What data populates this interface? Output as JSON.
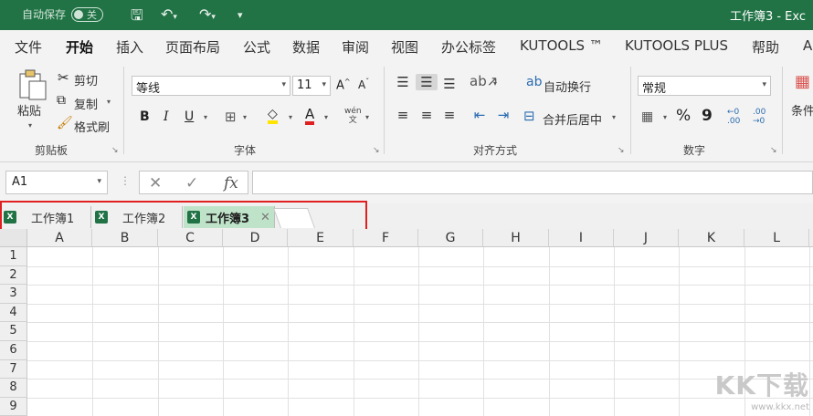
{
  "titlebar": {
    "autosave_label": "自动保存",
    "autosave_state": "关",
    "title": "工作簿3  -  Exc"
  },
  "menu": [
    "文件",
    "开始",
    "插入",
    "页面布局",
    "公式",
    "数据",
    "审阅",
    "视图",
    "办公标签",
    "KUTOOLS ™",
    "KUTOOLS PLUS",
    "帮助",
    "A"
  ],
  "menu_active": "开始",
  "ribbon": {
    "clipboard": {
      "paste": "粘贴",
      "cut": "剪切",
      "copy": "复制",
      "format_painter": "格式刷",
      "label": "剪贴板"
    },
    "font": {
      "font_name": "等线",
      "font_size": "11",
      "bold": "B",
      "italic": "I",
      "underline": "U",
      "grow": "A˄",
      "shrink": "A˅",
      "wen": "wén\n文",
      "label": "字体"
    },
    "align": {
      "wrap": "自动换行",
      "merge": "合并后居中",
      "label": "对齐方式"
    },
    "number": {
      "format": "常规",
      "percent": "%",
      "comma": "9",
      "inc": "←0\n.00",
      "dec": ".00\n→0",
      "label": "数字"
    },
    "styles": {
      "cond": "条件"
    }
  },
  "formula": {
    "namebox": "A1",
    "cancel": "✕",
    "enter": "✓",
    "fx": "fx",
    "value": ""
  },
  "workbook_tabs": [
    {
      "label": "工作簿1",
      "active": false
    },
    {
      "label": "工作簿2",
      "active": false
    },
    {
      "label": "工作簿3",
      "active": true
    }
  ],
  "columns": [
    "A",
    "B",
    "C",
    "D",
    "E",
    "F",
    "G",
    "H",
    "I",
    "J",
    "K",
    "L"
  ],
  "rows": [
    "1",
    "2",
    "3",
    "4",
    "5",
    "6",
    "7",
    "8",
    "9"
  ],
  "watermark": {
    "logo": "KK下载",
    "url": "www.kkx.net"
  },
  "colors": {
    "brand": "#217346",
    "active_tab": "#bfe3c9",
    "highlight_box": "#e02020"
  }
}
